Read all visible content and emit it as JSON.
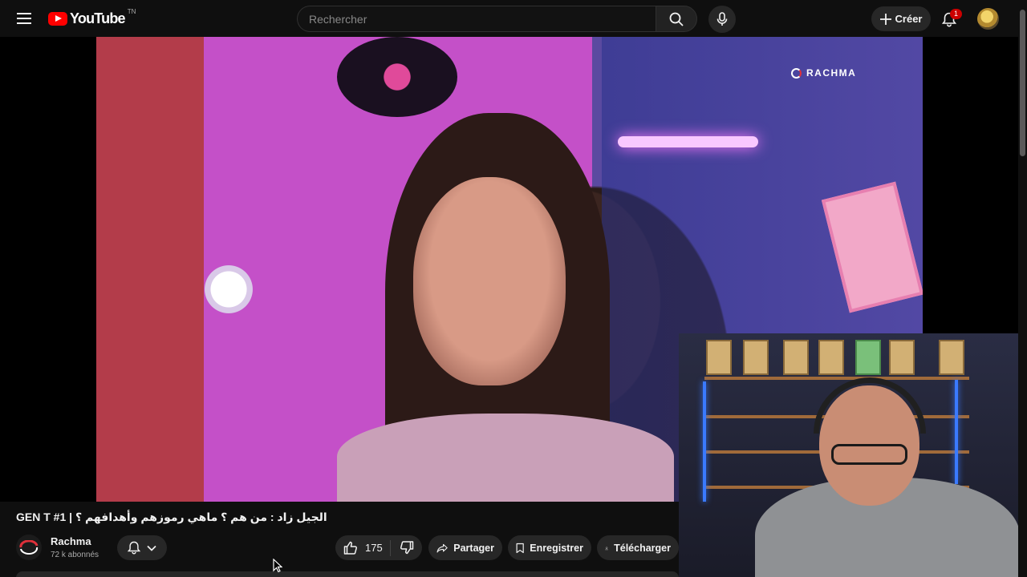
{
  "header": {
    "logo_text": "YouTube",
    "logo_suffix": "TN",
    "search_placeholder": "Rechercher",
    "create_label": "Créer",
    "notifications_count": "1"
  },
  "video": {
    "watermark": "RACHMA",
    "title": "GEN T #1 | الجيل زاد : من هم ؟ ماهي رموزهم وأهدافهم ؟"
  },
  "channel": {
    "name": "Rachma",
    "subscribers": "72 k abonnés"
  },
  "actions": {
    "like_count": "175",
    "share_label": "Partager",
    "save_label": "Enregistrer",
    "download_label": "Télécharger"
  },
  "colors": {
    "background": "#0f0f0f",
    "brand_red": "#ff0000",
    "button_bg": "#272727",
    "badge_red": "#cc0000"
  },
  "icons": [
    "menu-icon",
    "youtube-logo",
    "search-icon",
    "mic-icon",
    "plus-icon",
    "bell-icon",
    "chevron-down-icon",
    "thumbs-up-icon",
    "thumbs-down-icon",
    "share-icon",
    "bookmark-icon",
    "download-icon"
  ]
}
